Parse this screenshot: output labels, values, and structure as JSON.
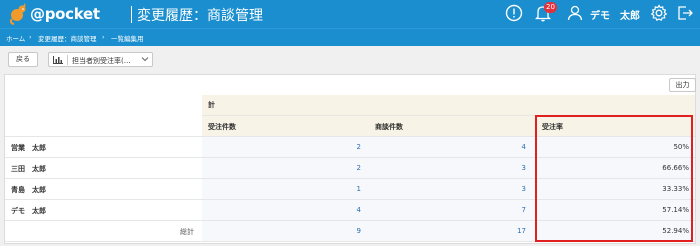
{
  "header": {
    "logo_text": "@pocket",
    "page_title": "変更履歴：商談管理",
    "notification_count": "20",
    "user_name": "デモ　太郎"
  },
  "breadcrumb": [
    "ホーム",
    "›",
    "変更履歴：商談管理",
    "›",
    "一覧編集用"
  ],
  "toolbar": {
    "back_label": "戻る",
    "report_select_value": "担当者別受注率(…"
  },
  "panel": {
    "export_label": "出力",
    "group_header": "計",
    "columns": [
      "受注件数",
      "商談件数",
      "受注率"
    ],
    "rows": [
      {
        "label": "営業　太郎",
        "orders": "2",
        "deals": "4",
        "rate": "50%"
      },
      {
        "label": "三田　太郎",
        "orders": "2",
        "deals": "3",
        "rate": "66.66%"
      },
      {
        "label": "青島　太郎",
        "orders": "1",
        "deals": "3",
        "rate": "33.33%"
      },
      {
        "label": "デモ　太郎",
        "orders": "4",
        "deals": "7",
        "rate": "57.14%"
      }
    ],
    "total": {
      "label": "総計",
      "orders": "9",
      "deals": "17",
      "rate": "52.94%"
    }
  },
  "colors": {
    "header_blue": "#1a8ecf",
    "badge_red": "#e2323c",
    "highlight_red": "#e02020",
    "link_blue": "#2a6fb8"
  }
}
